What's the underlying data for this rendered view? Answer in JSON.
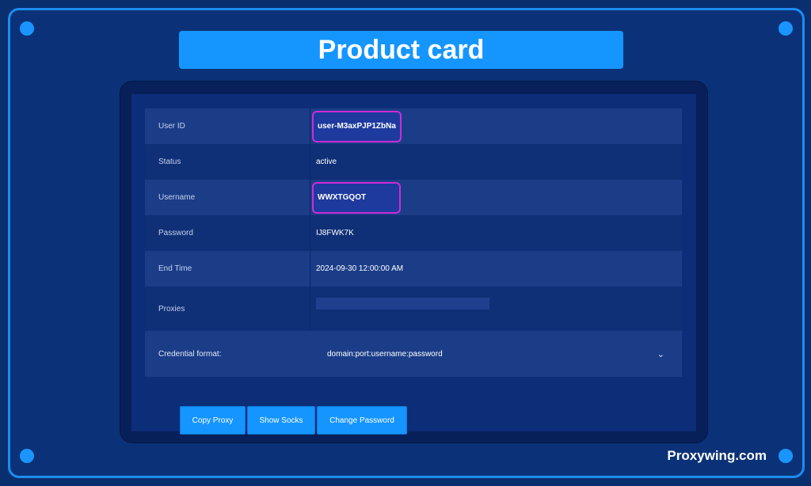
{
  "header": {
    "title": "Product card"
  },
  "table": {
    "rows": [
      {
        "label": "User ID",
        "value": "user-M3axPJP1ZbNa"
      },
      {
        "label": "Status",
        "value": "active"
      },
      {
        "label": "Username",
        "value": "WWXTGQOT"
      },
      {
        "label": "Password",
        "value": "IJ8FWK7K"
      },
      {
        "label": "End Time",
        "value": "2024-09-30 12:00:00 AM"
      },
      {
        "label": "Proxies",
        "value": ""
      }
    ],
    "credential": {
      "label": "Credential format:",
      "value": "domain:port:username:password"
    }
  },
  "buttons": {
    "copy_proxy": "Copy Proxy",
    "show_socks": "Show Socks",
    "change_password": "Change Password"
  },
  "footer": {
    "brand": "Proxywing.com"
  },
  "colors": {
    "accent": "#1596ff",
    "highlight_border": "#cf2bd6",
    "background": "#0a2f6e"
  },
  "icons": {
    "dropdown": "chevron-down-icon"
  }
}
